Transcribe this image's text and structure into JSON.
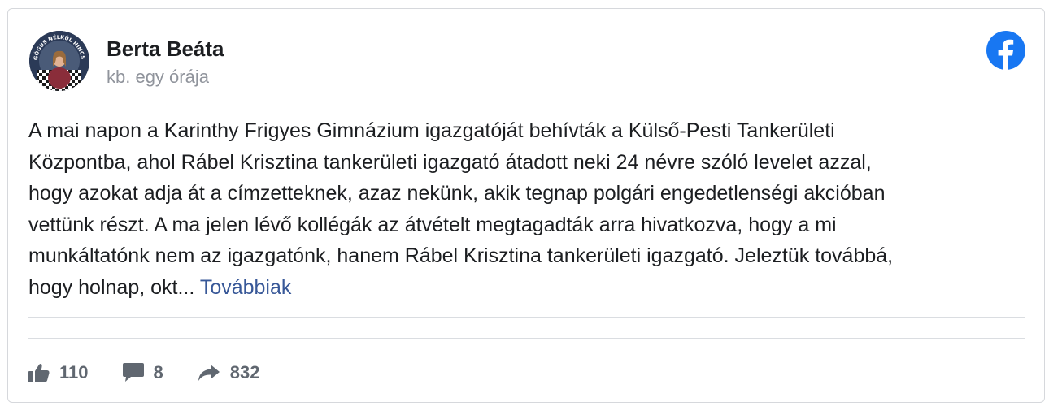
{
  "post": {
    "author_name": "Berta Beáta",
    "timestamp": "kb. egy órája",
    "text": "A mai napon a Karinthy Frigyes Gimnázium igazgatóját behívták a Külső-Pesti Tankerületi\nKözpontba, ahol Rábel Krisztina tankerületi igazgató átadott neki 24 névre szóló levelet azzal,\nhogy azokat adja át a címzetteknek, azaz nekünk, akik tegnap polgári engedetlenségi akcióban\nvettünk részt. A ma jelen lévő kollégák az átvételt megtagadták arra hivatkozva, hogy a mi\nmunkáltatónk nem az igazgatónk, hanem Rábel Krisztina tankerületi igazgató. Jeleztük továbbá,\nhogy holnap, okt... ",
    "see_more": "Továbbiak",
    "avatar_ring_text": "PEDAGÓGUS NÉLKÜL NINCS JÖVŐ"
  },
  "actions": {
    "likes": "110",
    "comments": "8",
    "shares": "832"
  },
  "icons": {
    "brand": "facebook-icon",
    "like": "thumbs-up-icon",
    "comment": "comment-icon",
    "share": "share-arrow-icon"
  },
  "colors": {
    "facebook_blue": "#1877f2",
    "link": "#385898",
    "muted_text": "#90949c",
    "action_gray": "#606770"
  }
}
